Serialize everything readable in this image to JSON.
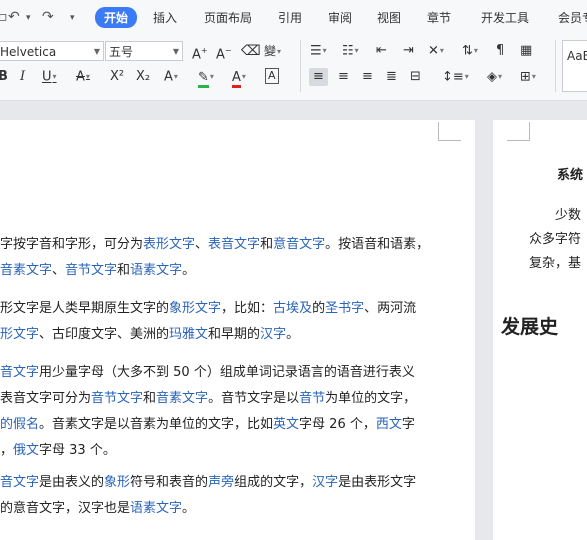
{
  "ribbon": {
    "quick": [
      "↶",
      "▾",
      "▾"
    ],
    "tabs": {
      "home": "开始",
      "insert": "插入",
      "layout": "页面布局",
      "references": "引用",
      "review": "审阅",
      "view": "视图",
      "chapter": "章节",
      "devtools": "开发工具",
      "member": "会员专"
    },
    "font_name": "Helvetica",
    "font_size": "五号",
    "font_grow": "A⁺",
    "font_shrink": "A⁻",
    "clear_format": "◇",
    "phonetic": "wén",
    "bold": "B",
    "italic": "I",
    "underline": "U",
    "strike": "A",
    "superscript": "X²",
    "subscript": "X₂",
    "text_effect": "A",
    "highlight": "🖍",
    "font_color": "A",
    "char_border": "A",
    "styles_label": "AaB"
  },
  "page1": {
    "p1": [
      [
        [
          "t",
          "字按字音和字形，可分为"
        ],
        [
          "l",
          "表形文字"
        ],
        [
          "t",
          "、"
        ],
        [
          "l",
          "表音文字"
        ],
        [
          "t",
          "和"
        ],
        [
          "l",
          "意音文字"
        ],
        [
          "t",
          "。按语音和语素，"
        ]
      ],
      [
        [
          "l",
          "音素文字"
        ],
        [
          "t",
          "、"
        ],
        [
          "l",
          "音节文字"
        ],
        [
          "t",
          "和"
        ],
        [
          "l",
          "语素文字"
        ],
        [
          "t",
          "。"
        ]
      ]
    ],
    "p2": [
      [
        [
          "t",
          "形文字是人类早期原生文字的"
        ],
        [
          "l",
          "象形文字"
        ],
        [
          "t",
          "，比如："
        ],
        [
          "l",
          "古埃及"
        ],
        [
          "t",
          "的"
        ],
        [
          "l",
          "圣书字"
        ],
        [
          "t",
          "、两河流"
        ]
      ],
      [
        [
          "l",
          "形文字"
        ],
        [
          "t",
          "、古印度文字、美洲的"
        ],
        [
          "l",
          "玛雅文"
        ],
        [
          "t",
          "和早期的"
        ],
        [
          "l",
          "汉字"
        ],
        [
          "t",
          "。"
        ]
      ]
    ],
    "p3": [
      [
        [
          "l",
          "音文字"
        ],
        [
          "t",
          "用少量字母（大多不到 50 个）组成单词记录语言的语音进行表义"
        ]
      ],
      [
        [
          "t",
          "表音文字可分为"
        ],
        [
          "l",
          "音节文字"
        ],
        [
          "t",
          "和"
        ],
        [
          "l",
          "音素文字"
        ],
        [
          "t",
          "。音节文字是以"
        ],
        [
          "l",
          "音节"
        ],
        [
          "t",
          "为单位的文字，"
        ]
      ],
      [
        [
          "l",
          "的假名"
        ],
        [
          "t",
          "。音素文字是以音素为单位的文字，比如"
        ],
        [
          "l",
          "英文"
        ],
        [
          "t",
          "字母 26 个，"
        ],
        [
          "l",
          "西文"
        ],
        [
          "t",
          "字"
        ]
      ],
      [
        [
          "t",
          "，"
        ],
        [
          "l",
          "俄文"
        ],
        [
          "t",
          "字母 33 个。"
        ]
      ]
    ],
    "p4": [
      [
        [
          "l",
          "音文字"
        ],
        [
          "t",
          "是由表义的"
        ],
        [
          "l",
          "象形"
        ],
        [
          "t",
          "符号和表音的"
        ],
        [
          "l",
          "声旁"
        ],
        [
          "t",
          "组成的文字，"
        ],
        [
          "l",
          "汉字"
        ],
        [
          "t",
          "是由表形文字"
        ]
      ],
      [
        [
          "t",
          "的意音文字，汉字也是"
        ],
        [
          "l",
          "语素文字"
        ],
        [
          "t",
          "。"
        ]
      ]
    ]
  },
  "page2": {
    "title": "系统",
    "line1": "少数",
    "line2": "众多字符",
    "line3": "复杂，基",
    "heading": "发展史"
  }
}
